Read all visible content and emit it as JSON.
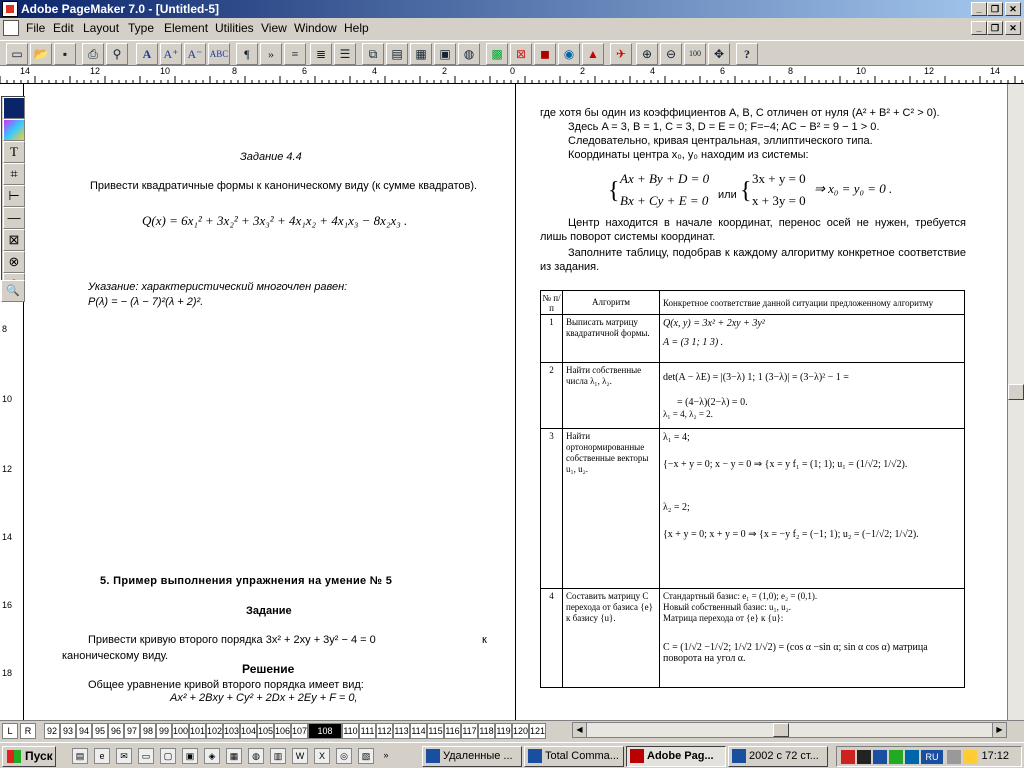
{
  "app": {
    "title": "Adobe PageMaker 7.0 - [Untitled-5]",
    "menu": [
      "File",
      "Edit",
      "Layout",
      "Type",
      "Element",
      "Utilities",
      "View",
      "Window",
      "Help"
    ]
  },
  "toolbar": {
    "icons": [
      "new-icon",
      "open-icon",
      "save-icon",
      "print-icon",
      "find-icon",
      "font-icon",
      "font-larger-icon",
      "font-smaller-icon",
      "spell-check-icon",
      "paragraph-icon",
      "indent-icon",
      "list-icon",
      "list-indent-icon",
      "align-icon",
      "copy-icon",
      "paste-icon",
      "document-icon",
      "links-icon",
      "ink-icon",
      "image-icon",
      "frame-icon",
      "color-icon",
      "globe-icon",
      "pdf-icon",
      "acrobat-icon",
      "zoom-in-icon",
      "zoom-out-icon",
      "actual-size-icon",
      "fit-icon",
      "help-icon"
    ],
    "zoom_label": "100"
  },
  "ruler": {
    "h_labels": [
      "14",
      "12",
      "10",
      "8",
      "6",
      "4",
      "2",
      "0",
      "2",
      "4",
      "6",
      "8",
      "10",
      "12",
      "14"
    ],
    "v_labels": [
      "8",
      "10",
      "12",
      "14",
      "16",
      "18"
    ]
  },
  "toolbox": [
    "pointer-tool",
    "color-tool",
    "text-tool",
    "crop-tool",
    "line-tool",
    "constrained-line-tool",
    "rectangle-tool",
    "ellipse-tool",
    "polygon-tool",
    "zoom-tool"
  ],
  "left_page": {
    "task_title": "Задание 4.4",
    "task_text": "Привести квадратичные формы к каноническому виду (к сумме квадратов).",
    "formula": "Q(x) = 6x₁² + 3x₂² + 3x₃² + 4x₁x₂ + 4x₁x₃ − 8x₂x₃ .",
    "hint": "Указание: характеристический многочлен равен:",
    "hint_formula": "P(λ) = − (λ − 7)²(λ + 2)².",
    "section_title": "5. Пример выполнения упражнения на умение № 5",
    "subsection": "Задание",
    "task2_a": "Привести кривую второго порядка 3x² + 2xy + 3y² − 4 = 0",
    "task2_k": "к",
    "task2_b": "каноническому виду.",
    "solution": "Решение",
    "general_eq_label": "Общее уравнение кривой второго порядка имеет вид:",
    "general_eq": "Ax² + 2Bxy + Cy² + 2Dx + 2Ey + F = 0,"
  },
  "right_page": {
    "line1": "где хотя бы один из коэффициентов A, B, C отличен от нуля (A² + B² + C² > 0).",
    "line2": "Здесь A = 3,   B = 1,   C = 3,   D = E = 0;   F=−4;   AC − B² = 9 − 1 > 0.",
    "line3": "Следовательно, кривая центральная, эллиптического типа.",
    "line4": "Координаты центра x₀, y₀ находим из системы:",
    "sys1_a": "Ax + By + D = 0",
    "sys1_b": "Bx + Cy + E = 0",
    "or": "или",
    "sys2_a": "3x + y = 0",
    "sys2_b": "x + 3y = 0",
    "sys_result": "⇒ x₀ = y₀ = 0 .",
    "para1": "Центр находится в начале координат, перенос осей не нужен, требуется лишь поворот системы координат.",
    "para2": "Заполните таблицу, подобрав к каждому алгоритму конкретное соответствие из задания.",
    "table": {
      "h_num": "№ п/п",
      "h_alg": "Алгоритм",
      "h_match": "Конкретное соответствие данной ситуации предложенному алгоритму",
      "rows": [
        {
          "n": "1",
          "alg": "Выписать матрицу квадратичной формы.",
          "m1": "Q(x, y) = 3x² + 2xy + 3y²",
          "m2": "A = (3 1; 1 3) ."
        },
        {
          "n": "2",
          "alg": "Найти собственные числа λ₁, λ₂.",
          "m1": "det(A − λE) = |(3−λ) 1; 1 (3−λ)| = (3−λ)² − 1 =",
          "m2": "= (4−λ)(2−λ) = 0.",
          "m3": "λ₁ = 4, λ₂ = 2."
        },
        {
          "n": "3",
          "alg": "Найти ортонормированные собственные векторы u₁, u₂.",
          "m1": "λ₁ = 4;",
          "m2": "{−x + y = 0; x − y = 0 ⇒ {x = y   f₁ = (1; 1);   u₁ = (1/√2; 1/√2).",
          "m3": "λ₂ = 2;",
          "m4": "{x + y = 0; x + y = 0 ⇒ {x = −y   f₂ = (−1; 1);   u₂ = (−1/√2; 1/√2)."
        },
        {
          "n": "4",
          "alg": "Составить матрицу C перехода от базиса {e} к базису {u}.",
          "m1": "Стандартный базис: e₁ = (1,0); e₂ = (0,1).",
          "m2": "Новый собственный базис: u₁, u₂.",
          "m3": "Матрица перехода от {e} к {u}:",
          "m4": "C = (1/√2 −1/√2; 1/√2 1/√2) = (cos α  −sin α; sin α  cos α) матрица поворота на угол α."
        }
      ]
    }
  },
  "pages": {
    "lr": [
      "L",
      "R"
    ],
    "numbers": [
      "92",
      "93",
      "94",
      "95",
      "96",
      "97",
      "98",
      "99",
      "100",
      "101",
      "102",
      "103",
      "104",
      "105",
      "106",
      "107",
      "108",
      "109",
      "110",
      "111",
      "112",
      "113",
      "114",
      "115",
      "116",
      "117",
      "118",
      "119",
      "120",
      "121"
    ],
    "active": "108 109"
  },
  "taskbar": {
    "start": "Пуск",
    "tasks": [
      "Удаленные ...",
      "Total Comma...",
      "Adobe Pag...",
      "2002 с 72 ст..."
    ],
    "active_task": "Adobe Pag...",
    "lang": "RU",
    "clock": "17:12"
  }
}
